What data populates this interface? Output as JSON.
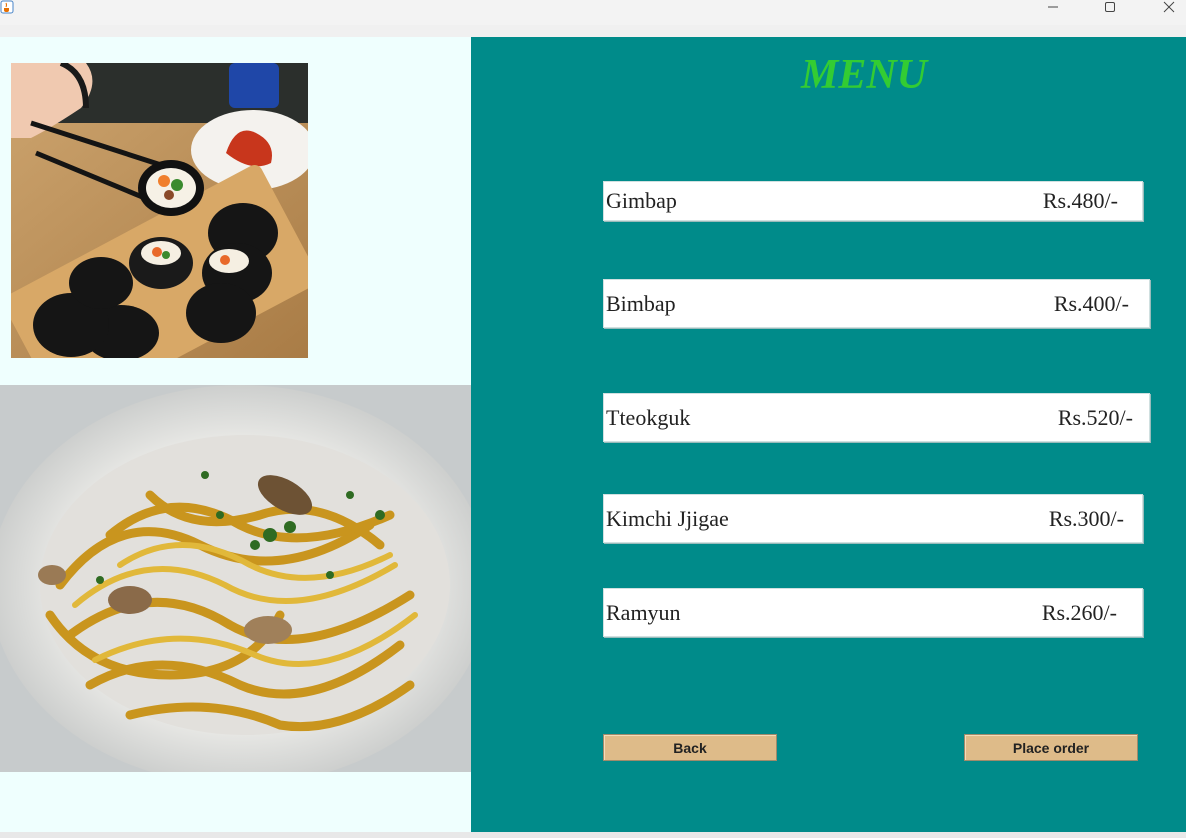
{
  "window": {
    "icon": "java-cup-icon",
    "controls": [
      "minimize-icon",
      "maximize-icon",
      "close-icon"
    ]
  },
  "images": {
    "top": "kimbap-photo",
    "bottom": "noodle-pasta-photo"
  },
  "menu": {
    "title": "MENU",
    "title_color": "#33cc33",
    "items": [
      {
        "name": "Gimbap",
        "price": "Rs.480/-"
      },
      {
        "name": "Bimbap",
        "price": "Rs.400/-"
      },
      {
        "name": "Tteokguk",
        "price": "Rs.520/-"
      },
      {
        "name": "Kimchi Jjigae",
        "price": "Rs.300/-"
      },
      {
        "name": "Ramyun",
        "price": "Rs.260/-"
      }
    ]
  },
  "actions": {
    "back_label": "Back",
    "place_order_label": "Place order"
  },
  "colors": {
    "panel_bg": "#008b8a",
    "left_bg": "#effffe",
    "button_bg": "#debb89"
  }
}
